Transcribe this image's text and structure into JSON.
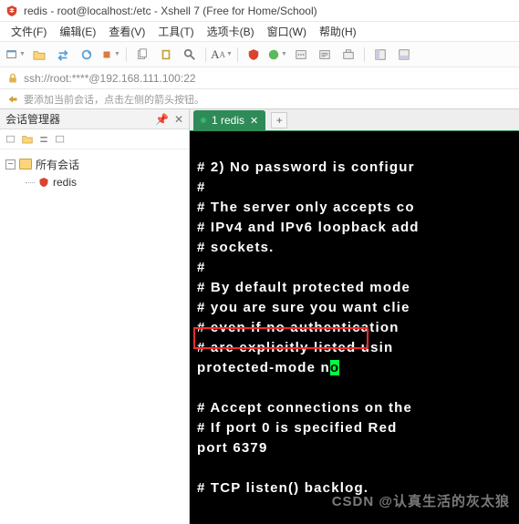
{
  "window": {
    "title": "redis - root@localhost:/etc - Xshell 7 (Free for Home/School)"
  },
  "menu": {
    "file": "文件(F)",
    "edit": "编辑(E)",
    "view": "查看(V)",
    "tools": "工具(T)",
    "tab": "选项卡(B)",
    "window": "窗口(W)",
    "help": "帮助(H)"
  },
  "address": {
    "text": "ssh://root:****@192.168.111.100:22"
  },
  "hint": {
    "text": "要添加当前会话，点击左侧的箭头按钮。"
  },
  "sidebar": {
    "title": "会话管理器",
    "root": "所有会话",
    "items": [
      {
        "label": "redis"
      }
    ]
  },
  "tabs": {
    "active": "1 redis"
  },
  "terminal": {
    "lines": [
      "# 2) No password is configur",
      "#",
      "# The server only accepts co",
      "# IPv4 and IPv6 loopback add",
      "# sockets.",
      "#",
      "# By default protected mode ",
      "# you are sure you want clie",
      "# even if no authentication ",
      "# are explicitly listed usin",
      "protected-mode n",
      "o",
      "",
      "# Accept connections on the ",
      "# If port 0 is specified Red",
      "port 6379",
      "",
      "# TCP listen() backlog."
    ]
  },
  "watermark": "CSDN @认真生活的灰太狼"
}
